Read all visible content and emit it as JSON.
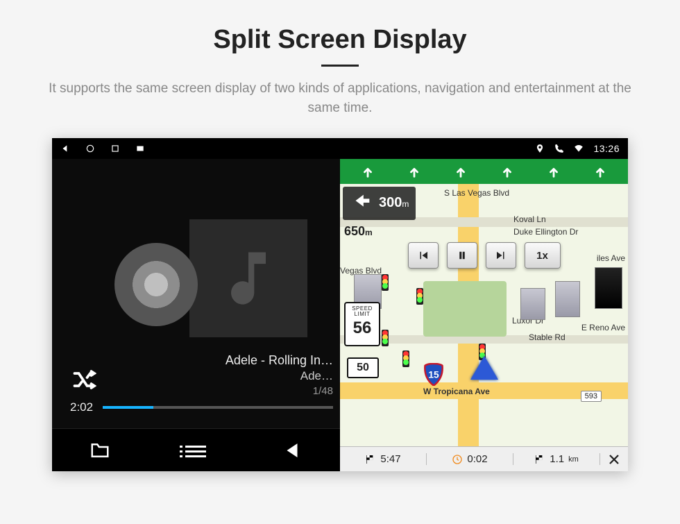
{
  "page": {
    "title": "Split Screen Display",
    "subtitle": "It supports the same screen display of two kinds of applications, navigation and entertainment at the same time."
  },
  "statusbar": {
    "time": "13:26"
  },
  "music": {
    "track_title": "Adele - Rolling In…",
    "track_artist": "Ade…",
    "track_index": "1/48",
    "elapsed": "2:02"
  },
  "nav": {
    "lane_count": 6,
    "turn_distance_main": "300",
    "turn_distance_main_unit": "m",
    "turn_distance_secondary": "650",
    "turn_distance_secondary_unit": "m",
    "speed_limit_label": "SPEED LIMIT",
    "speed_limit_value": "56",
    "route_shield": "50",
    "interstate_shield": "15",
    "playback_speed": "1x",
    "streets": {
      "s_las_vegas_blvd": "S Las Vegas Blvd",
      "koval_ln": "Koval Ln",
      "duke_ellington_dr": "Duke Ellington Dr",
      "luxor_dr": "Luxor Dr",
      "stable_rd": "Stable Rd",
      "e_reno_ave": "E Reno Ave",
      "w_tropicana_ave": "W Tropicana Ave",
      "vegas_blvd_short": "Vegas Blvd",
      "iles_ave": "iles Ave"
    },
    "street_pill": "593",
    "bottom": {
      "arrival_time": "5:47",
      "travel_hours": "0:02",
      "remaining_distance": "1.1",
      "remaining_distance_unit": "km"
    }
  }
}
